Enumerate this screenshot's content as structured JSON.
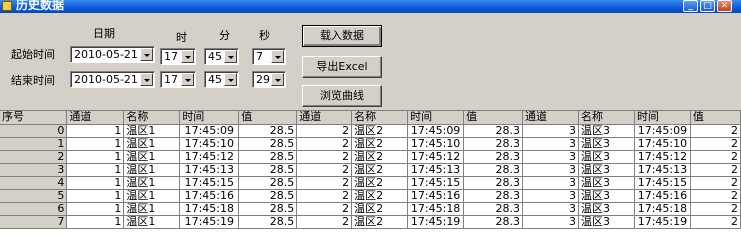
{
  "window": {
    "title": "历史数据"
  },
  "header": {
    "date": "日期",
    "hour": "时",
    "minute": "分",
    "second": "秒"
  },
  "start": {
    "label": "起始时间",
    "date": "2010-05-21",
    "hour": "17",
    "minute": "45",
    "second": "7"
  },
  "end": {
    "label": "结束时间",
    "date": "2010-05-21",
    "hour": "17",
    "minute": "45",
    "second": "29"
  },
  "buttons": {
    "load": "载入数据",
    "export": "导出Excel",
    "browse": "浏览曲线"
  },
  "columns": [
    "序号",
    "通道",
    "名称",
    "时间",
    "值",
    "通道",
    "名称",
    "时间",
    "值",
    "通道",
    "名称",
    "时间",
    "值"
  ],
  "rows": [
    [
      "0",
      "1",
      "温区1",
      "17:45:09",
      "28.5",
      "2",
      "温区2",
      "17:45:09",
      "28.3",
      "3",
      "温区3",
      "17:45:09",
      "2"
    ],
    [
      "1",
      "1",
      "温区1",
      "17:45:10",
      "28.5",
      "2",
      "温区2",
      "17:45:10",
      "28.3",
      "3",
      "温区3",
      "17:45:10",
      "2"
    ],
    [
      "2",
      "1",
      "温区1",
      "17:45:12",
      "28.5",
      "2",
      "温区2",
      "17:45:12",
      "28.3",
      "3",
      "温区3",
      "17:45:12",
      "2"
    ],
    [
      "3",
      "1",
      "温区1",
      "17:45:13",
      "28.5",
      "2",
      "温区2",
      "17:45:13",
      "28.3",
      "3",
      "温区3",
      "17:45:13",
      "2"
    ],
    [
      "4",
      "1",
      "温区1",
      "17:45:15",
      "28.5",
      "2",
      "温区2",
      "17:45:15",
      "28.3",
      "3",
      "温区3",
      "17:45:15",
      "2"
    ],
    [
      "5",
      "1",
      "温区1",
      "17:45:16",
      "28.5",
      "2",
      "温区2",
      "17:45:16",
      "28.3",
      "3",
      "温区3",
      "17:45:16",
      "2"
    ],
    [
      "6",
      "1",
      "温区1",
      "17:45:18",
      "28.5",
      "2",
      "温区2",
      "17:45:18",
      "28.3",
      "3",
      "温区3",
      "17:45:18",
      "2"
    ],
    [
      "7",
      "1",
      "温区1",
      "17:45:19",
      "28.5",
      "2",
      "温区2",
      "17:45:19",
      "28.3",
      "3",
      "温区3",
      "17:45:19",
      "2"
    ]
  ]
}
